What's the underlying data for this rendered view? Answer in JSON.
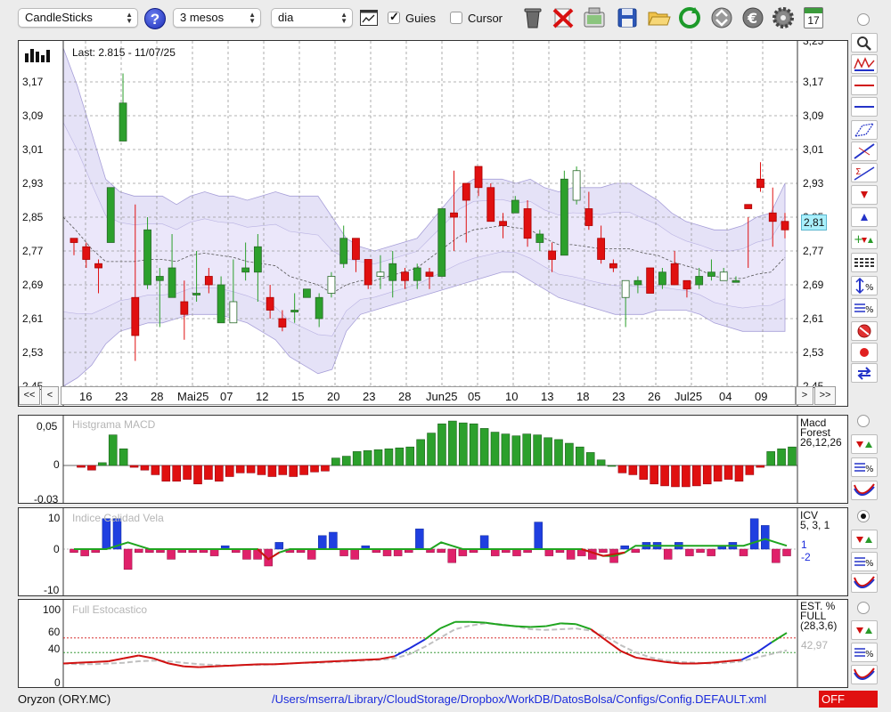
{
  "toolbar": {
    "chart_type": "CandleSticks",
    "period": "3 mesos",
    "interval": "dia",
    "guides_label": "Guies",
    "guides_checked": true,
    "cursor_label": "Cursor",
    "cursor_checked": false,
    "icons": [
      "help-icon",
      "table-icon",
      "trash-icon",
      "delete-icon",
      "screenshot-icon",
      "save-icon",
      "open-folder-icon",
      "refresh-icon",
      "sync-icon",
      "currency-icon",
      "settings-icon",
      "calendar-icon"
    ],
    "calendar_day": "17"
  },
  "main_chart": {
    "last_label": "Last: 2.815 - 11/07/25",
    "price_badge": "2,81",
    "yticks": [
      "3,17",
      "3,09",
      "3,01",
      "2,93",
      "2,85",
      "2,77",
      "2,69",
      "2,61",
      "2,53",
      "2,45"
    ],
    "ytick_values": [
      3.17,
      3.09,
      3.01,
      2.93,
      2.85,
      2.77,
      2.69,
      2.61,
      2.53,
      2.45
    ],
    "top_cut_label": "3,25",
    "xlabels": [
      "16",
      "23",
      "28",
      "Mai25",
      "07",
      "12",
      "15",
      "20",
      "23",
      "28",
      "Jun25",
      "05",
      "10",
      "13",
      "18",
      "23",
      "26",
      "Jul25",
      "04",
      "09"
    ],
    "nav": {
      "first": "<<",
      "prev": "<",
      "next": ">",
      "last": ">>"
    }
  },
  "macd": {
    "title": "Histgrama MACD",
    "label_line1": "Macd",
    "label_line2": "Forest",
    "label_line3": "26,12,26",
    "yticks": [
      "0,05",
      "0",
      "-0,03"
    ]
  },
  "icv": {
    "title": "Indice Calidad Vela",
    "label_line1": "ICV",
    "label_line2": "5, 3, 1",
    "value1": "1",
    "value2": "-2",
    "yticks": [
      "10",
      "0",
      "-10"
    ]
  },
  "stoch": {
    "title": "Full Estocastico",
    "label_line1": "EST. %",
    "label_line2": "FULL",
    "label_line3": "(28,3,6)",
    "value": "42,97",
    "yticks": [
      "100",
      "60",
      "40",
      "0"
    ]
  },
  "footer": {
    "ticker": "Oryzon (ORY.MC)",
    "path": "/Users/mserra/Library/CloudStorage/Dropbox/WorkDB/DatosBolsa/Configs/Config.DEFAULT.xml",
    "status": "OFF"
  },
  "colors": {
    "up": "#2ca02c",
    "down": "#e01010",
    "band": "#dcd8f4",
    "band_edge": "#a79fd8",
    "accent": "#1b2bdc"
  },
  "chart_data": [
    {
      "type": "candlestick",
      "title": "Last: 2.815 - 11/07/25",
      "ylim": [
        2.45,
        3.25
      ],
      "candles": [
        [
          2.8,
          2.8,
          2.76,
          2.79
        ],
        [
          2.78,
          2.79,
          2.73,
          2.75
        ],
        [
          2.74,
          2.75,
          2.67,
          2.73
        ],
        [
          2.79,
          2.92,
          2.79,
          2.92
        ],
        [
          3.03,
          3.19,
          3.03,
          3.12
        ],
        [
          2.66,
          2.88,
          2.51,
          2.57
        ],
        [
          2.69,
          2.85,
          2.68,
          2.82
        ],
        [
          2.7,
          2.73,
          2.59,
          2.71
        ],
        [
          2.66,
          2.81,
          2.69,
          2.73
        ],
        [
          2.65,
          2.7,
          2.56,
          2.62
        ],
        [
          2.67,
          2.77,
          2.65,
          2.67
        ],
        [
          2.71,
          2.73,
          2.67,
          2.69
        ],
        [
          2.6,
          2.71,
          2.6,
          2.69
        ],
        [
          2.6,
          2.75,
          2.6,
          2.65
        ],
        [
          2.72,
          2.79,
          2.7,
          2.73
        ],
        [
          2.72,
          2.81,
          2.65,
          2.78
        ],
        [
          2.66,
          2.69,
          2.61,
          2.63
        ],
        [
          2.61,
          2.63,
          2.58,
          2.59
        ],
        [
          2.63,
          2.67,
          2.6,
          2.63
        ],
        [
          2.66,
          2.68,
          2.66,
          2.68
        ],
        [
          2.61,
          2.67,
          2.59,
          2.66
        ],
        [
          2.67,
          2.72,
          2.66,
          2.71
        ],
        [
          2.74,
          2.83,
          2.73,
          2.8
        ],
        [
          2.8,
          2.78,
          2.72,
          2.75
        ],
        [
          2.75,
          2.75,
          2.68,
          2.69
        ],
        [
          2.71,
          2.76,
          2.68,
          2.72
        ],
        [
          2.7,
          2.77,
          2.66,
          2.74
        ],
        [
          2.72,
          2.73,
          2.68,
          2.7
        ],
        [
          2.7,
          2.74,
          2.68,
          2.73
        ],
        [
          2.72,
          2.73,
          2.68,
          2.71
        ],
        [
          2.71,
          2.84,
          2.71,
          2.87
        ],
        [
          2.86,
          2.96,
          2.77,
          2.85
        ],
        [
          2.93,
          2.93,
          2.79,
          2.89
        ],
        [
          2.97,
          2.97,
          2.9,
          2.92
        ],
        [
          2.92,
          2.93,
          2.84,
          2.84
        ],
        [
          2.84,
          2.86,
          2.8,
          2.83
        ],
        [
          2.86,
          2.9,
          2.86,
          2.89
        ],
        [
          2.87,
          2.89,
          2.78,
          2.8
        ],
        [
          2.79,
          2.82,
          2.77,
          2.81
        ],
        [
          2.77,
          2.79,
          2.72,
          2.75
        ],
        [
          2.76,
          2.96,
          2.76,
          2.94
        ],
        [
          2.89,
          2.97,
          2.88,
          2.96
        ],
        [
          2.87,
          2.91,
          2.82,
          2.83
        ],
        [
          2.8,
          2.83,
          2.74,
          2.75
        ],
        [
          2.74,
          2.75,
          2.72,
          2.73
        ],
        [
          2.66,
          2.68,
          2.59,
          2.7
        ],
        [
          2.69,
          2.71,
          2.67,
          2.7
        ],
        [
          2.73,
          2.73,
          2.69,
          2.67
        ],
        [
          2.69,
          2.73,
          2.68,
          2.72
        ],
        [
          2.74,
          2.77,
          2.69,
          2.69
        ],
        [
          2.7,
          2.7,
          2.66,
          2.68
        ],
        [
          2.69,
          2.73,
          2.68,
          2.71
        ],
        [
          2.71,
          2.75,
          2.7,
          2.72
        ],
        [
          2.7,
          2.73,
          2.7,
          2.72
        ],
        [
          2.7,
          2.71,
          2.7,
          2.7
        ],
        [
          2.88,
          2.85,
          2.73,
          2.87
        ],
        [
          2.94,
          2.98,
          2.91,
          2.92
        ],
        [
          2.86,
          2.92,
          2.78,
          2.84
        ],
        [
          2.84,
          2.86,
          2.8,
          2.82
        ]
      ]
    },
    {
      "type": "bar",
      "title": "Histgrama MACD",
      "ylim": [
        -0.03,
        0.05
      ],
      "values": [
        -0.002,
        -0.005,
        0.003,
        0.033,
        0.018,
        -0.002,
        -0.005,
        -0.01,
        -0.017,
        -0.017,
        -0.015,
        -0.02,
        -0.015,
        -0.017,
        -0.012,
        -0.008,
        -0.008,
        -0.01,
        -0.012,
        -0.01,
        -0.012,
        -0.01,
        -0.007,
        -0.006,
        0.008,
        0.01,
        0.015,
        0.016,
        0.017,
        0.018,
        0.019,
        0.02,
        0.028,
        0.035,
        0.045,
        0.048,
        0.046,
        0.045,
        0.04,
        0.036,
        0.034,
        0.032,
        0.034,
        0.033,
        0.03,
        0.028,
        0.024,
        0.02,
        0.014,
        0.006,
        0.0,
        -0.008,
        -0.01,
        -0.015,
        -0.02,
        -0.022,
        -0.023,
        -0.023,
        -0.022,
        -0.02,
        -0.017,
        -0.015,
        -0.017,
        -0.01,
        -0.002,
        0.015,
        0.018,
        0.02
      ]
    },
    {
      "type": "bar",
      "title": "Indice Calidad Vela",
      "ylim": [
        -10,
        10
      ],
      "values": [
        -1,
        -2,
        -1,
        9,
        9,
        -6,
        -1,
        -1,
        -1,
        -3,
        -1,
        -1,
        -1,
        -2,
        1,
        -1,
        -3,
        -3,
        -5,
        2,
        -1,
        -1,
        -3,
        4,
        5,
        -2,
        -3,
        1,
        -1,
        -2,
        -2,
        -1,
        6,
        -1,
        -1,
        -4,
        -2,
        -1,
        4,
        -2,
        -1,
        -2,
        -1,
        8,
        -2,
        -1,
        -3,
        -2,
        -3,
        -1,
        -4,
        1,
        -1,
        2,
        2,
        -3,
        2,
        -2,
        -1,
        -2,
        1,
        2,
        -2,
        9,
        7,
        -4,
        -2
      ]
    },
    {
      "type": "line",
      "title": "Full Estocastico",
      "ylim": [
        0,
        100
      ],
      "series": [
        {
          "values": [
            25,
            26,
            27,
            28,
            32,
            36,
            32,
            25,
            21,
            20,
            21,
            22,
            23,
            24,
            24,
            25,
            26,
            27,
            28,
            29,
            30,
            31,
            35,
            46,
            58,
            73,
            82,
            82,
            81,
            78,
            76,
            75,
            76,
            80,
            79,
            72,
            57,
            42,
            33,
            30,
            27,
            25,
            25,
            26,
            28,
            30,
            40,
            54,
            67
          ]
        },
        {
          "values": [
            25,
            24,
            24,
            25,
            26,
            28,
            29,
            28,
            26,
            24,
            23,
            22,
            23,
            23,
            24,
            25,
            26,
            26,
            27,
            28,
            29,
            30,
            32,
            38,
            48,
            60,
            72,
            77,
            80,
            79,
            76,
            72,
            71,
            72,
            73,
            70,
            62,
            50,
            40,
            33,
            29,
            27,
            26,
            25,
            26,
            28,
            33,
            38,
            43
          ]
        }
      ]
    }
  ]
}
